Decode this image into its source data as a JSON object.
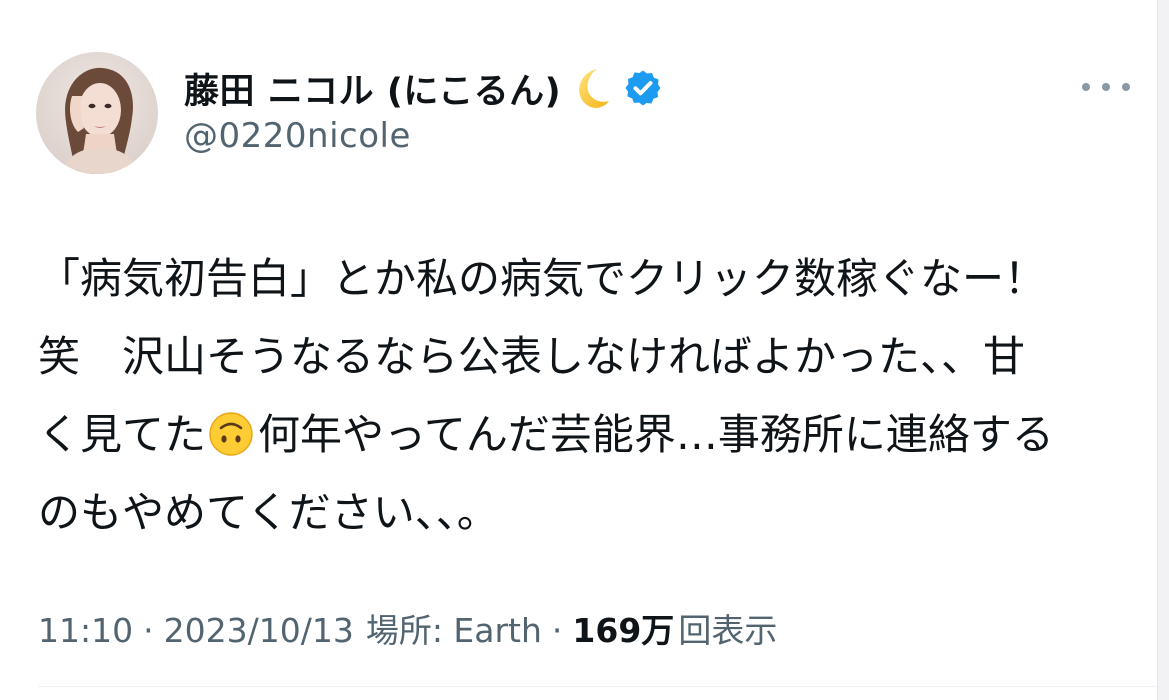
{
  "author": {
    "display_name": "藤田 ニコル (にこるん)",
    "name_emoji": "crescent-moon",
    "verified": true,
    "handle": "@0220nicole",
    "avatar_icon": "profile-photo"
  },
  "tweet": {
    "line1": "「病気初告白」とか私の病気でクリック数稼ぐなー！",
    "line2": "笑　沢山そうなるなら公表しなければよかった、、甘",
    "line3_before_emoji": "く見てた",
    "line3_emoji": "upside-down-face",
    "line3_after_emoji": "何年やってんだ芸能界…事務所に連絡する",
    "line4": "のもやめてください、、。"
  },
  "meta": {
    "time": "11:10",
    "separator": "·",
    "date": "2023/10/13",
    "location_label": "場所: Earth",
    "views_count": "169万",
    "views_label": "回表示"
  },
  "colors": {
    "text_primary": "#0f1419",
    "text_secondary": "#536471",
    "verified_blue": "#1d9bf0",
    "background": "#ffffff"
  }
}
